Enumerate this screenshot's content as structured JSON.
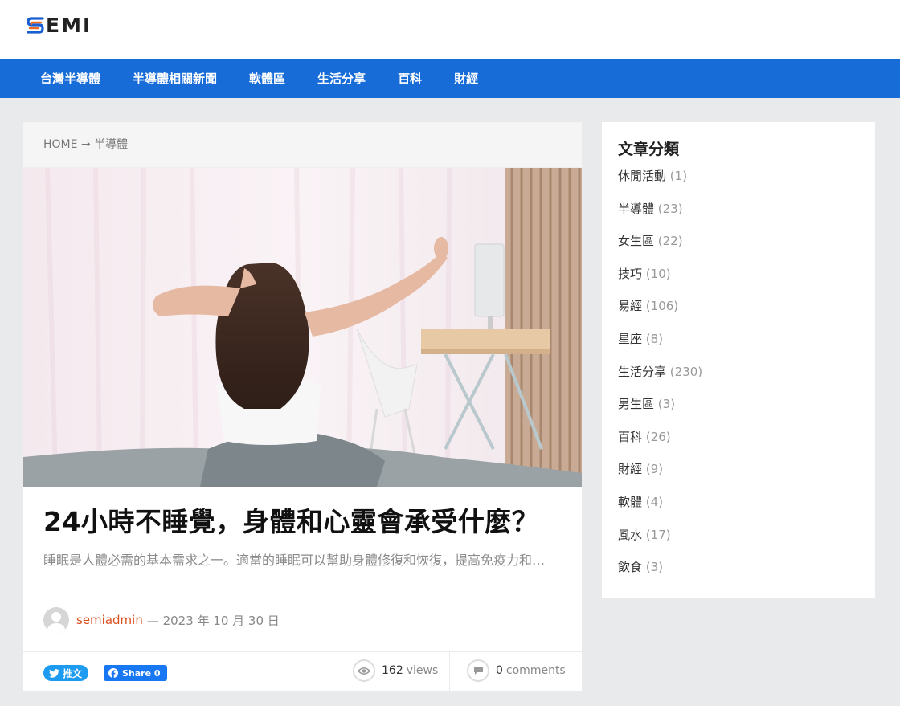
{
  "logo": {
    "text": "EMI",
    "letter": "S"
  },
  "nav": [
    {
      "label": "台灣半導體"
    },
    {
      "label": "半導體相關新聞"
    },
    {
      "label": "軟體區"
    },
    {
      "label": "生活分享"
    },
    {
      "label": "百科"
    },
    {
      "label": "財經"
    }
  ],
  "breadcrumb": {
    "home": "HOME",
    "arrow": "→",
    "current": "半導體"
  },
  "post": {
    "title": "24小時不睡覺，身體和心靈會承受什麼？",
    "excerpt": "睡眠是人體必需的基本需求之一。適當的睡眠可以幫助身體修復和恢復，提高免疫力和…",
    "author": "semiadmin",
    "date": "— 2023 年 10 月 30 日",
    "tweet_label": "推文",
    "fb_label": "Share 0",
    "views_count": "162",
    "views_label": "views",
    "comments_count": "0",
    "comments_label": "comments"
  },
  "sidebar": {
    "title": "文章分類",
    "categories": [
      {
        "name": "休閒活動",
        "count": "(1)"
      },
      {
        "name": "半導體",
        "count": "(23)"
      },
      {
        "name": "女生區",
        "count": "(22)"
      },
      {
        "name": "技巧",
        "count": "(10)"
      },
      {
        "name": "易經",
        "count": "(106)"
      },
      {
        "name": "星座",
        "count": "(8)"
      },
      {
        "name": "生活分享",
        "count": "(230)"
      },
      {
        "name": "男生區",
        "count": "(3)"
      },
      {
        "name": "百科",
        "count": "(26)"
      },
      {
        "name": "財經",
        "count": "(9)"
      },
      {
        "name": "軟體",
        "count": "(4)"
      },
      {
        "name": "風水",
        "count": "(17)"
      },
      {
        "name": "飲食",
        "count": "(3)"
      }
    ]
  },
  "colors": {
    "nav_bg": "#176cd8",
    "author": "#d9501f",
    "twitter": "#1d9bf0",
    "facebook": "#1877f2",
    "logo_blue": "#1a5fd0",
    "logo_orange": "#f06a1e"
  },
  "hero_image": {
    "icon": "woman-stretching-bed-photo"
  }
}
